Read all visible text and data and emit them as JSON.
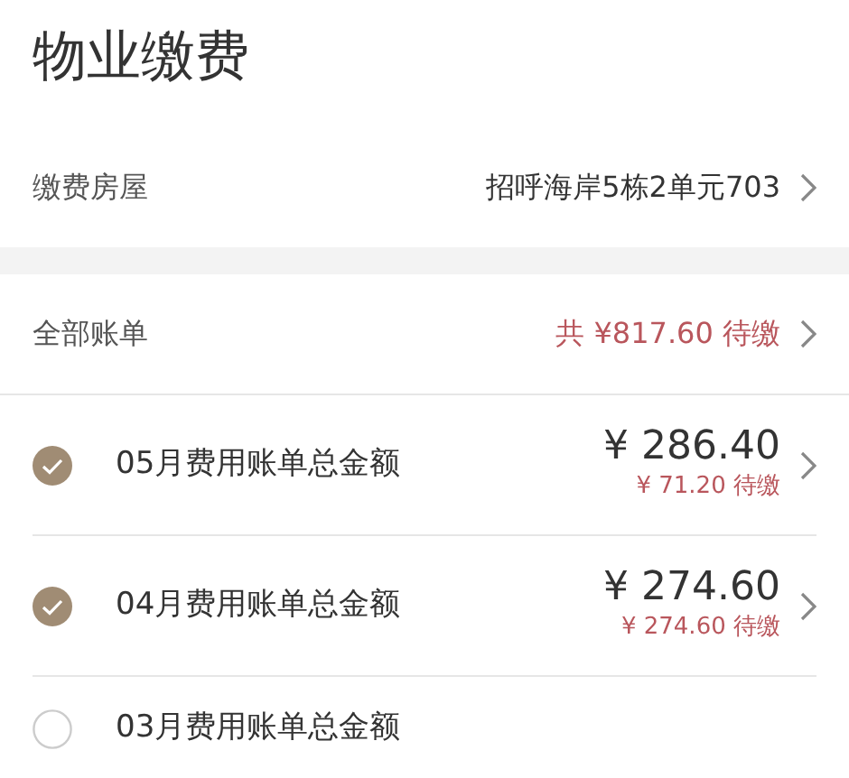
{
  "title": "物业缴费",
  "house": {
    "label": "缴费房屋",
    "value": "招呼海岸5栋2单元703"
  },
  "summary": {
    "label": "全部账单",
    "total": "共 ¥817.60 待缴"
  },
  "bills": [
    {
      "label": "05月费用账单总金额",
      "amount": "¥ 286.40",
      "due": "¥ 71.20 待缴",
      "checked": true
    },
    {
      "label": "04月费用账单总金额",
      "amount": "¥ 274.60",
      "due": "¥ 274.60 待缴",
      "checked": true
    },
    {
      "label": "03月费用账单总金额",
      "checked": false
    }
  ]
}
